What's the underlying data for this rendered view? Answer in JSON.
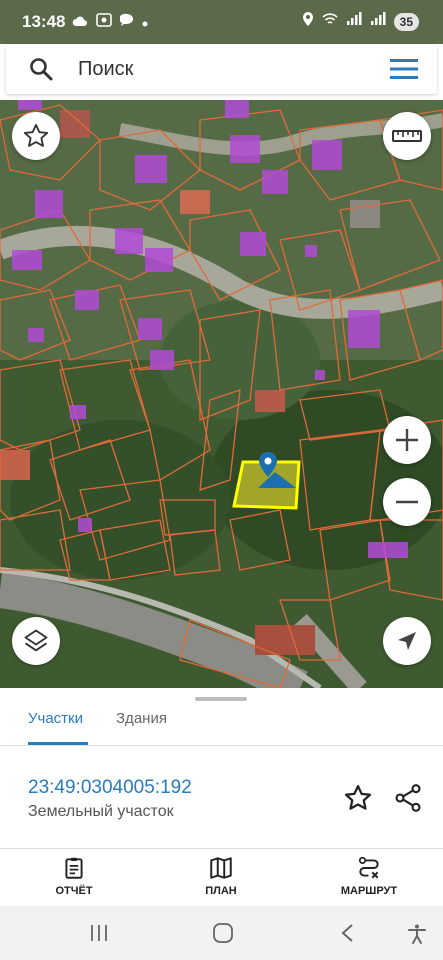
{
  "status_bar": {
    "time": "13:48",
    "battery": "35"
  },
  "search": {
    "placeholder": "Поиск"
  },
  "map": {
    "selected_parcel_color": "#ffff00",
    "building_color": "#b24bd6",
    "parcel_border_color": "#e06a3a"
  },
  "tabs": [
    {
      "label": "Участки",
      "active": true
    },
    {
      "label": "Здания",
      "active": false
    }
  ],
  "parcel": {
    "cadastral_number": "23:49:0304005:192",
    "type": "Земельный участок"
  },
  "bottom_nav": [
    {
      "label": "ОТЧЁТ",
      "icon": "report-icon"
    },
    {
      "label": "ПЛАН",
      "icon": "map-plan-icon"
    },
    {
      "label": "МАРШРУТ",
      "icon": "route-icon"
    }
  ],
  "colors": {
    "accent": "#2a7bbd"
  }
}
